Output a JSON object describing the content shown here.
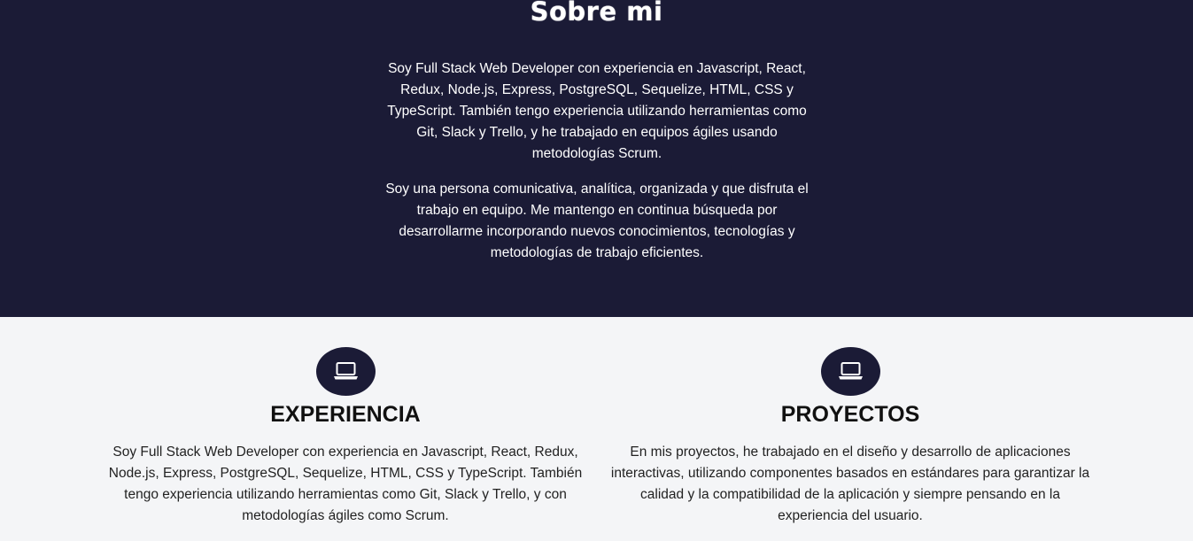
{
  "about": {
    "title": "Sobre mi",
    "paragraph_1": "Soy Full Stack Web Developer con experiencia en Javascript, React, Redux, Node.js, Express, PostgreSQL, Sequelize, HTML, CSS y TypeScript. También tengo experiencia utilizando herramientas como Git, Slack y Trello, y he trabajado en equipos ágiles usando metodologías Scrum.",
    "paragraph_2": "Soy una persona comunicativa, analítica, organizada y que disfruta el trabajo en equipo. Me mantengo en continua búsqueda por desarrollarme incorporando nuevos conocimientos, tecnologías y metodologías de trabajo eficientes."
  },
  "cards": [
    {
      "icon": "laptop-icon",
      "title": "EXPERIENCIA",
      "text": "Soy Full Stack Web Developer con experiencia en Javascript, React, Redux, Node.js, Express, PostgreSQL, Sequelize, HTML, CSS y TypeScript. También tengo experiencia utilizando herramientas como Git, Slack y Trello, y con metodologías ágiles como Scrum."
    },
    {
      "icon": "laptop-icon",
      "title": "PROYECTOS",
      "text": "En mis proyectos, he trabajado en el diseño y desarrollo de aplicaciones interactivas, utilizando componentes basados en estándares para garantizar la calidad y la compatibilidad de la aplicación y siempre pensando en la experiencia del usuario."
    }
  ],
  "colors": {
    "dark_bg": "#1b1b36",
    "light_bg": "#f4f5f7",
    "text_on_dark": "#ffffff",
    "text_on_light": "#111111"
  }
}
